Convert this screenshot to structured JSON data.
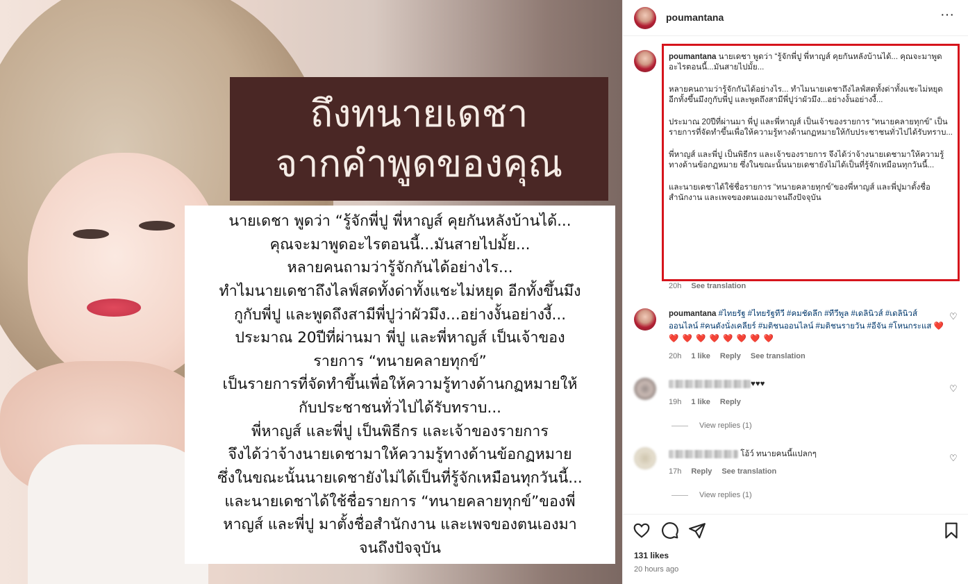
{
  "image": {
    "title_lines": [
      "ถึงทนายเดชา",
      "จากคำพูดของคุณ"
    ],
    "body_lines": [
      "นายเดชา พูดว่า “รู้จักพี่ปู พี่หาญส์ คุยกันหลังบ้านได้...",
      "คุณจะมาพูดอะไรตอนนี้...มันสายไปมั้ย...",
      "หลายคนถามว่ารู้จักกันได้อย่างไร...",
      "ทำไมนายเดชาถึงไลฟ์สดทั้งด่าทั้งแชะไม่หยุด อีกทั้งขึ้นมึง",
      "กูกับพี่ปู และพูดถึงสามีพี่ปูว่าผัวมึง...อย่างงั้นอย่างงี้...",
      "ประมาณ 20ปีที่ผ่านมา พี่ปู และพี่หาญส์ เป็นเจ้าของ",
      "รายการ “ทนายคลายทุกข์”",
      "เป็นรายการที่จัดทำขึ้นเพื่อให้ความรู้ทางด้านกฏหมายให้",
      "กับประชาชนทั่วไปได้รับทราบ...",
      "พี่หาญส์ และพี่ปู เป็นพิธีกร และเจ้าของรายการ",
      "จึงได้ว่าจ้างนายเดชามาให้ความรู้ทางด้านข้อกฏหมาย",
      "ซึ่งในขณะนั้นนายเดชายังไม่ได้เป็นที่รู้จักเหมือนทุกวันนี้...",
      "และนายเดชาได้ใช้ชื่อรายการ “ทนายคลายทุกข์”ของพี่",
      "หาญส์ และพี่ปู มาตั้งชื่อสำนักงาน และเพจของตนเองมา",
      "จนถึงปัจจุบัน"
    ]
  },
  "header": {
    "username": "poumantana",
    "more_label": "···"
  },
  "caption": {
    "username": "poumantana",
    "paragraphs": [
      "นายเดชา พูดว่า “รู้จักพี่ปู พี่หาญส์ คุยกันหลังบ้านได้... คุณจะมาพูดอะไรตอนนี้...มันสายไปมั้ย...",
      "หลายคนถามว่ารู้จักกันได้อย่างไร... ทำไมนายเดชาถึงไลฟ์สดทั้งด่าทั้งแชะไม่หยุด อีกทั้งขึ้นมึงกูกับพี่ปู และพูดถึงสามีพี่ปูว่าผัวมึง...อย่างงั้นอย่างงี้...",
      "ประมาณ 20ปีที่ผ่านมา พี่ปู และพี่หาญส์ เป็นเจ้าของรายการ “ทนายคลายทุกข์” เป็นรายการที่จัดทำขึ้นเพื่อให้ความรู้ทางด้านกฏหมายให้กับประชาชนทั่วไปได้รับทราบ...",
      "พี่หาญส์ และพี่ปู เป็นพิธีกร และเจ้าของรายการ จึงได้ว่าจ้างนายเดชามาให้ความรู้ทางด้านข้อกฏหมาย ซึ่งในขณะนั้นนายเดชายังไม่ได้เป็นที่รู้จักเหมือนทุกวันนี้...",
      "และนายเดชาได้ใช้ชื่อรายการ “ทนายคลายทุกข์”ของพี่หาญส์ และพี่ปูมาตั้งชื่อสำนักงาน และเพจของตนเองมาจนถึงปัจจุบัน"
    ],
    "time": "20h",
    "see_translation": "See translation"
  },
  "comments": [
    {
      "username": "poumantana",
      "text": "#ไทยรัฐ #ไทยรัฐทีวี #คมชัดลึก #ทีวีพูล #เดลินิวส์ #เดลินิวส์ออนไลน์ #คนดังนั่งเคลียร์ #มติชนออนไลน์ #มติชนรายวัน #อีจัน #โหนกระแส",
      "hearts": "❤️ ❤️ ❤️ ❤️ ❤️ ❤️ ❤️ ❤️ ❤️",
      "time": "20h",
      "likes": "1 like",
      "reply": "Reply",
      "see_translation": "See translation"
    },
    {
      "text": "♥♥♥",
      "time": "19h",
      "likes": "1 like",
      "reply": "Reply",
      "view_replies": "View replies (1)"
    },
    {
      "text": "โอ้ว์ ทนายคนนี้แปลกๆ",
      "time": "17h",
      "reply": "Reply",
      "see_translation": "See translation",
      "view_replies": "View replies (1)"
    }
  ],
  "footer": {
    "likes": "131 likes",
    "time_ago": "20 hours ago"
  },
  "colors": {
    "highlight": "#d6141c",
    "title_bg": "#4a2725",
    "hashtag": "#00376b"
  }
}
